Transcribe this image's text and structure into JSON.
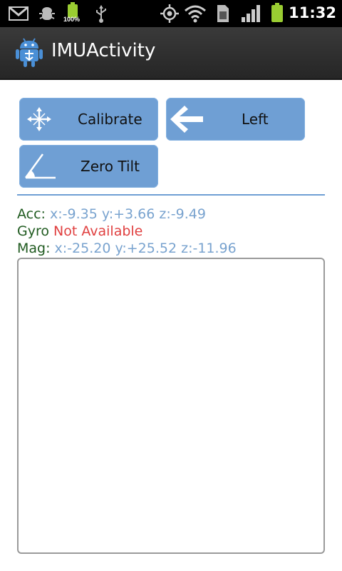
{
  "status_bar": {
    "icons": [
      "gmail-icon",
      "debug-icon",
      "battery-charging-icon",
      "usb-icon",
      "gps-icon",
      "wifi-icon",
      "sim-icon",
      "signal-icon",
      "battery-icon"
    ],
    "battery_label": "100%",
    "time": "11:32"
  },
  "title_bar": {
    "icon": "android-app-icon",
    "title": "IMUActivity"
  },
  "buttons": {
    "calibrate": {
      "label": "Calibrate",
      "icon": "calibrate-arrows-icon"
    },
    "left": {
      "label": "Left",
      "icon": "left-arrow-icon"
    },
    "zero_tilt": {
      "label": "Zero Tilt",
      "icon": "angle-icon"
    }
  },
  "sensors": {
    "acc": {
      "label": "Acc:",
      "value": "x:-9.35 y:+3.66 z:-9.49"
    },
    "gyro": {
      "label": "Gyro",
      "value": "Not Available"
    },
    "mag": {
      "label": "Mag:",
      "value": "x:-25.20 y:+25.52 z:-11.96"
    }
  },
  "colors": {
    "button": "#6f9fd4",
    "label_green": "#1f5a1f",
    "value_blue": "#79a3cf",
    "unavailable_red": "#e04040"
  }
}
